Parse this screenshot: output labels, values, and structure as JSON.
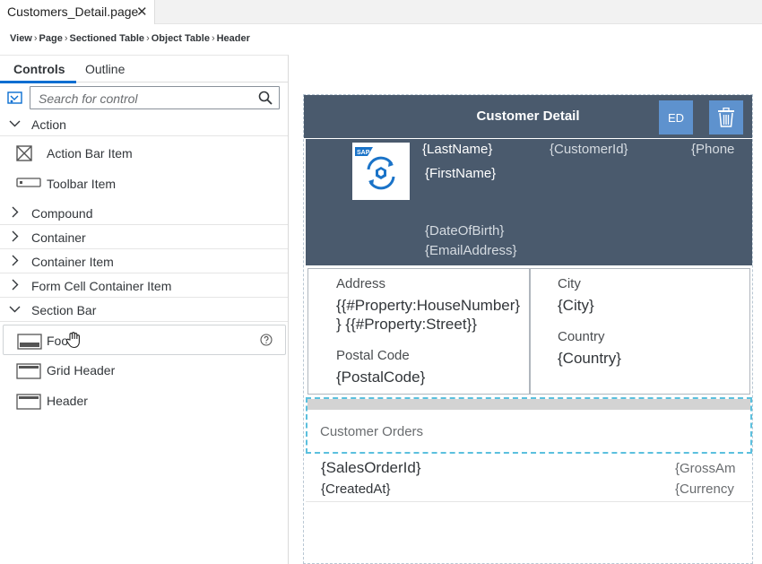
{
  "editor_tab": {
    "title": "Customers_Detail.page",
    "close_glyph": "✕"
  },
  "breadcrumb": [
    "View",
    "Page",
    "Sectioned Table",
    "Object Table",
    "Header"
  ],
  "left_panel": {
    "tabs": [
      "Controls",
      "Outline"
    ],
    "search_placeholder": "Search for control",
    "categories": {
      "action": "Action",
      "compound": "Compound",
      "container": "Container",
      "container_item": "Container Item",
      "form_cell_container_item": "Form Cell Container Item",
      "section_bar": "Section Bar"
    },
    "action_items": [
      "Action Bar Item",
      "Toolbar Item"
    ],
    "section_bar_items": [
      "Footer",
      "Grid Header",
      "Header"
    ],
    "hover_item_text": "Foo"
  },
  "canvas": {
    "appbar_title": "Customer Detail",
    "ed_button_label": "ED",
    "header": {
      "last_name": "{LastName}",
      "first_name": "{FirstName}",
      "customer_id": "{CustomerId}",
      "phone": "{Phone",
      "date_of_birth": "{DateOfBirth}",
      "email": "{EmailAddress}",
      "logo_text": "SAP"
    },
    "key_values": {
      "address_label": "Address",
      "address_line1": "{{#Property:HouseNumber}",
      "address_line2": "} {{#Property:Street}}",
      "postal_label": "Postal Code",
      "postal_value": "{PostalCode}",
      "city_label": "City",
      "city_value": "{City}",
      "country_label": "Country",
      "country_value": "{Country}"
    },
    "section_caption": "Customer Orders",
    "order_row": {
      "sales_order_id": "{SalesOrderId}",
      "created_at": "{CreatedAt}",
      "gross_amount": "{GrossAm",
      "currency": "{Currency"
    }
  },
  "colors": {
    "header_bg": "#4a5a6d",
    "button_bg": "#5e92ce",
    "accent": "#0a6ed1",
    "selection_dash": "#5bc0de"
  }
}
